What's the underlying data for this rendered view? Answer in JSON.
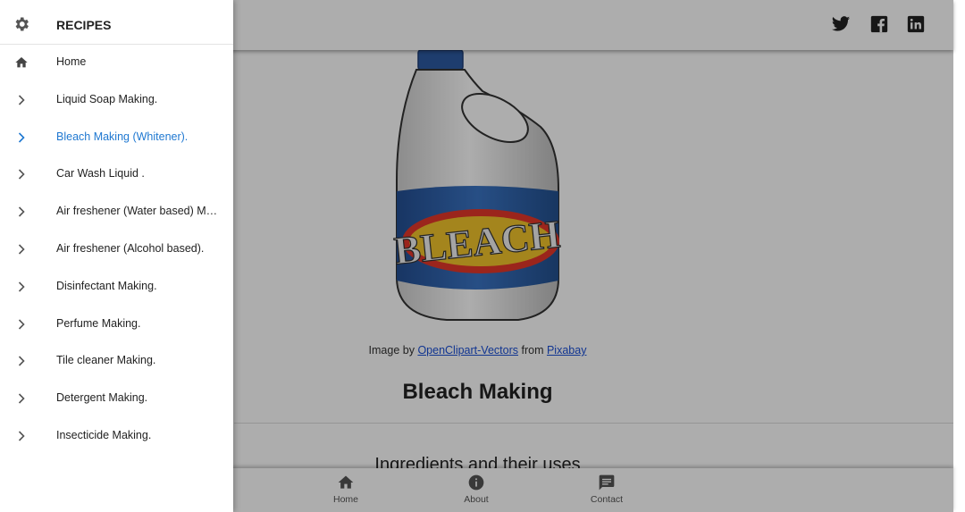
{
  "drawer": {
    "title": "RECIPES",
    "items": [
      {
        "label": "Home",
        "icon": "home-icon",
        "active": false
      },
      {
        "label": "Liquid Soap Making.",
        "icon": "chevron-right-icon",
        "active": false
      },
      {
        "label": "Bleach Making (Whitener).",
        "icon": "chevron-right-icon",
        "active": true
      },
      {
        "label": "Car Wash Liquid .",
        "icon": "chevron-right-icon",
        "active": false
      },
      {
        "label": "Air freshener (Water based) Making.",
        "icon": "chevron-right-icon",
        "active": false
      },
      {
        "label": "Air freshener (Alcohol based).",
        "icon": "chevron-right-icon",
        "active": false
      },
      {
        "label": "Disinfectant Making.",
        "icon": "chevron-right-icon",
        "active": false
      },
      {
        "label": "Perfume Making.",
        "icon": "chevron-right-icon",
        "active": false
      },
      {
        "label": "Tile cleaner Making.",
        "icon": "chevron-right-icon",
        "active": false
      },
      {
        "label": "Detergent Making.",
        "icon": "chevron-right-icon",
        "active": false
      },
      {
        "label": "Insecticide Making.",
        "icon": "chevron-right-icon",
        "active": false
      }
    ]
  },
  "header": {
    "social": [
      "twitter-icon",
      "facebook-icon",
      "linkedin-icon"
    ]
  },
  "hero": {
    "label_text": "BLEACH"
  },
  "credit": {
    "prefix": "Image by",
    "author": "OpenClipart-Vectors",
    "middle": "from",
    "source": "Pixabay"
  },
  "main": {
    "title": "Bleach Making",
    "section_title": "Ingredients and their uses"
  },
  "bottom_nav": {
    "items": [
      {
        "label": "Home",
        "icon": "home-icon"
      },
      {
        "label": "About",
        "icon": "info-icon"
      },
      {
        "label": "Contact",
        "icon": "message-icon"
      }
    ]
  },
  "colors": {
    "accent": "#1f78d1",
    "scrim": "rgba(0,0,0,0.32)",
    "bottle_blue": "#2f5fa8"
  }
}
